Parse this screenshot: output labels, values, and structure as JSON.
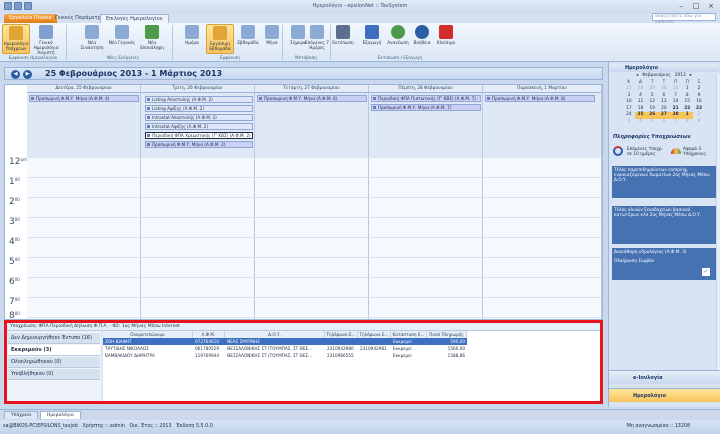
{
  "app": {
    "title": "Ημερολόγιο - epsilonNet :: TaxSystem",
    "help_search_placeholder": "αναζητήστε εδώ για επιλογές"
  },
  "ribbon_tabs": [
    "Εργαλεία Πίνακα",
    "Γενικές Παράμετροι",
    "Επιλογές Ημερολογίου"
  ],
  "ribbon": {
    "buttons": [
      {
        "label": "Ημερολόγιο Υπόχρεων"
      },
      {
        "label": "Γενικό Ημερολόγιο Λογιστή"
      },
      {
        "label": "Νέα Συνάντηση"
      },
      {
        "label": "Νέο Γεγονός"
      },
      {
        "label": "Νέα Επανάληψη"
      },
      {
        "label": "Ημέρα"
      },
      {
        "label": "Εργάσιμη Εβδομάδα"
      },
      {
        "label": "Εβδομάδα"
      },
      {
        "label": "Μήνα"
      },
      {
        "label": "Σήμερα"
      },
      {
        "label": "Επόμενες 7 Ημέρες"
      },
      {
        "label": "Εκτύπωση"
      },
      {
        "label": "Εξαγωγή"
      },
      {
        "label": "Ανανέωση"
      },
      {
        "label": "Βοήθεια"
      },
      {
        "label": "Κλείσιμο"
      }
    ],
    "groups": [
      "Εμφάνιση Ημερολογίου",
      "Νέες Ενέργειες",
      "Εμφάνιση",
      "Μετάβαση",
      "Εκτύπωση / Εξαγωγή"
    ]
  },
  "calendar": {
    "range": "25 Φεβρουάριος 2013 - 1 Μάρτιος 2013",
    "days": [
      "Δευτέρα, 25 Φεβρουαρίου",
      "Τρίτη, 26 Φεβρουαρίου",
      "Τετάρτη, 27 Φεβρουαρίου",
      "Πέμπτη, 28 Φεβρουαρίου",
      "Παρασκευή, 1 Μαρτίου"
    ],
    "appointments": {
      "mon": [
        "Προσωρινή Φ.Μ.Υ. Μήνα (Α.Φ.Μ. 4)"
      ],
      "tue": [
        "Listing Αποστολής (Α.Φ.Μ. 2)",
        "Listing Αφίξης (Α.Φ.Μ. 2)",
        "Intrastat Αποστολής (Α.Φ.Μ. 2)",
        "Intrastat Αφίξης (Α.Φ.Μ. 2)",
        "Περιοδική ΦΠΑ Χρεωστικής (Γ' ΚΒΣ) (Α.Φ.Μ. 2)",
        "Προσωρινή Φ.Μ.Υ. Μήνα (Α.Φ.Μ. 2)"
      ],
      "wed": [
        "Προσωρινή Φ.Μ.Υ. Μήνα (Α.Φ.Μ. 6)"
      ],
      "thu": [
        "Περιοδική ΦΠΑ Πιστωτικής (Γ' ΚΒΣ) (Α.Φ.Μ. 7)",
        "Προσωρινή Φ.Μ.Υ. Μήνα (Α.Φ.Μ. 7)"
      ],
      "fri": [
        "Προσωρινή Φ.Μ.Υ. Μήνα (Α.Φ.Μ. 8)"
      ]
    },
    "hours": [
      {
        "h": "12",
        "m": "pm"
      },
      {
        "h": "1",
        "m": "00"
      },
      {
        "h": "2",
        "m": "00"
      },
      {
        "h": "3",
        "m": "00"
      },
      {
        "h": "4",
        "m": "00"
      },
      {
        "h": "5",
        "m": "00"
      },
      {
        "h": "6",
        "m": "00"
      },
      {
        "h": "7",
        "m": "00"
      },
      {
        "h": "8",
        "m": "00"
      }
    ]
  },
  "obligations": {
    "caption": "Υποχρέωση: ΦΠΑ Περιοδική Δήλωση Φ.Π.Α. - Φ2: 1ος Μήνας Μέσω Internet",
    "categories": [
      {
        "label": "Δεν Δημιουργήθηκε Έντυπο (16)"
      },
      {
        "label": "Εκκρεμούν (3)"
      },
      {
        "label": "Ολοκληρώθηκαν (0)"
      },
      {
        "label": "Υποβλήθηκαν (0)"
      }
    ],
    "columns": [
      "Ονοματεπώνυμο",
      "Α.Φ.Μ.",
      "Δ.Ο.Υ.",
      "Τηλέφωνο Ε...",
      "Τηλέφωνο Ε...",
      "Κατάσταση Ε...",
      "Ποσό Πληρωμής"
    ],
    "rows": [
      [
        "ΖΟΗ ΔΙΑΦΗΤ",
        "072764610",
        "ΝΕΑΣ ΣΜΥΡΝΗΣ",
        "",
        "",
        "Εκκρεμεί",
        "590,00"
      ],
      [
        "ΤΑΥΤΙΔΗΣ ΝΙΚΟΛΑΟΣ",
        "061780529",
        "ΘΕΣΣΑΛΟΝΙΚΗΣ ΣΤ (ΤΟΥΜΠΑΣ, ΣΤ ΘΕΣ...",
        "2310942980",
        "2310942981",
        "Εκκρεμεί",
        "1560,00"
      ],
      [
        "ΒΑΜΒΑΚΙΔΟΥ ΔΗΜΗΤΡΑ",
        "119769944",
        "ΘΕΣΣΑΛΟΝΙΚΗΣ ΣΤ (ΤΟΥΜΠΑΣ, ΣΤ ΘΕΣ...",
        "2310966555",
        "",
        "Εκκρεμεί",
        "1588,86"
      ]
    ]
  },
  "side": {
    "calendar_title": "Ημερολόγιο",
    "month": "Φεβρουάριος",
    "year": "2013",
    "weekdays": [
      "Κ",
      "Δ",
      "Τ",
      "Τ",
      "Π",
      "Π",
      "Σ"
    ],
    "weeks": [
      [
        "27",
        "28",
        "29",
        "30",
        "31",
        "1",
        "2"
      ],
      [
        "3",
        "4",
        "5",
        "6",
        "7",
        "8",
        "9"
      ],
      [
        "10",
        "11",
        "12",
        "13",
        "14",
        "15",
        "16"
      ],
      [
        "17",
        "18",
        "19",
        "20",
        "21",
        "22",
        "23"
      ],
      [
        "24",
        "25",
        "26",
        "27",
        "28",
        "1",
        "2"
      ],
      [
        "3",
        "4",
        "5",
        "6",
        "7",
        "8",
        "9"
      ]
    ],
    "info_title": "Πληροφορίες Υποχρεώσεων",
    "next_label": "Επόμενες Υποχρ. σε 10 ημέρες",
    "concerns_label": "Αφορά 3 Υπόχρεους",
    "tiles": [
      "Τέλος παρεπιδημούντων camping, ενοικιαζόμενων δωματίων 2ος Μήνας Μέσω Δ.Ο.Υ.",
      "Τέλος κλινών ξενοδοχείων βασικού κατωτέρων κλπ 2ος Μήνας Μέσω Δ.Ο.Υ.",
      "Διακάθαρη υδρολόγιος (Α.Φ.Μ. 3)"
    ],
    "done_label": "Ολοήρωση Συμβάν",
    "nav_items": [
      "e-Ιονλογία",
      "Ημερολόγιο"
    ]
  },
  "doc_tabs": [
    "Υπόχρεοι",
    "Ημερολόγιο"
  ],
  "status": {
    "user_host": "sa@BIKOS-PC\\EPSILONS_taxjob",
    "user": "Χρήστης :: admin",
    "year": "Οικ. Έτος :: 2013",
    "version": "Έκδοση 5.5.0.0",
    "messages": "Μη αναγνωσμένα :: 13208"
  }
}
